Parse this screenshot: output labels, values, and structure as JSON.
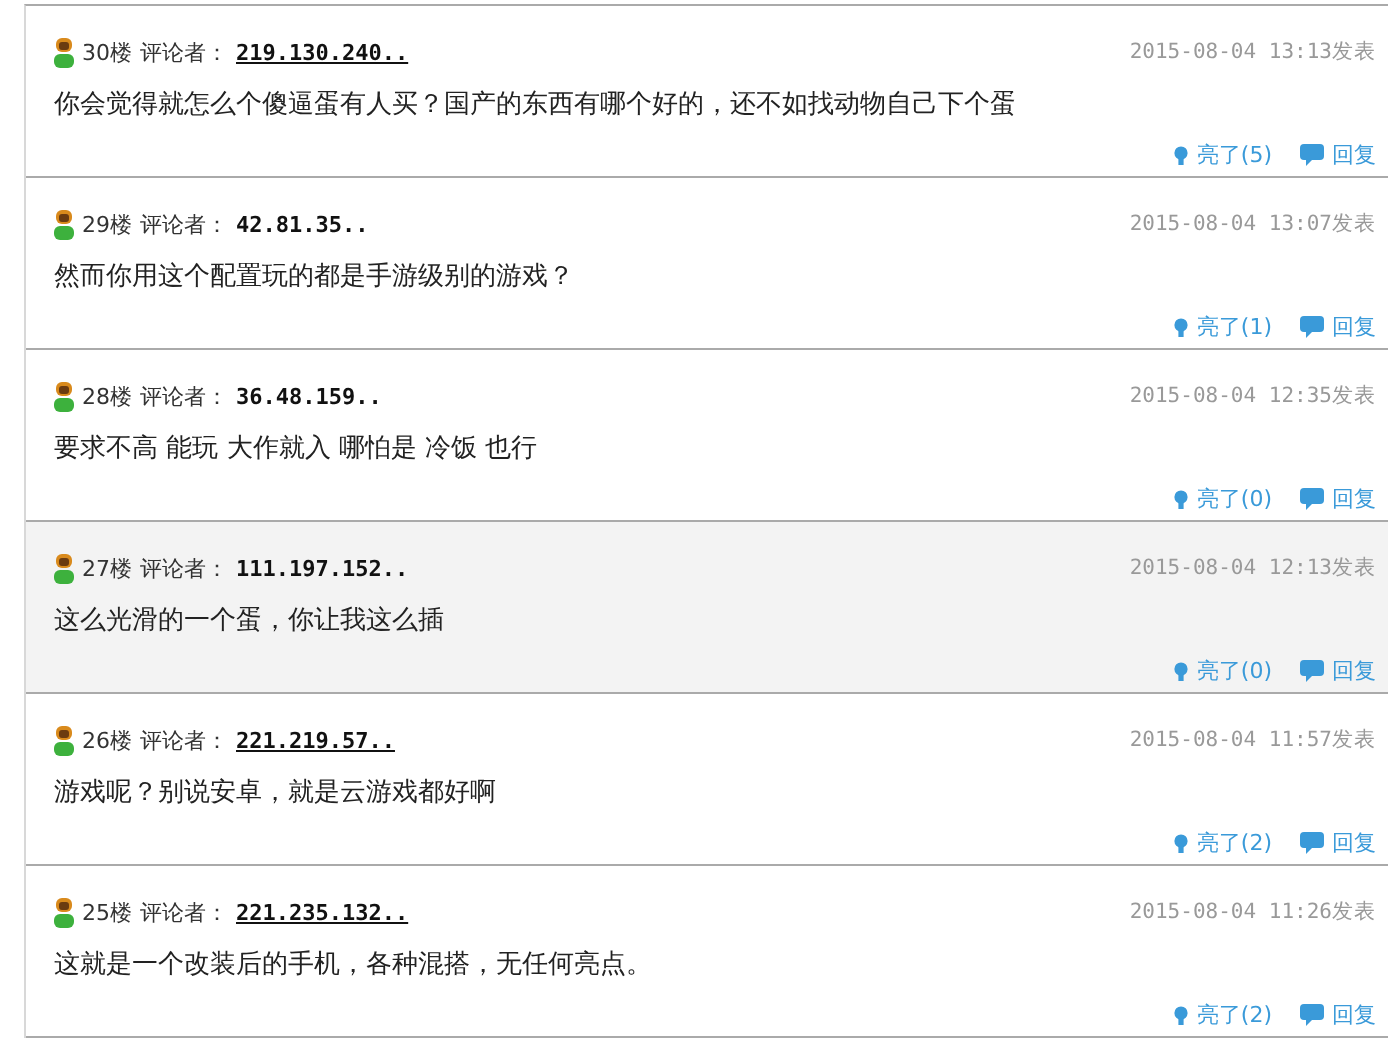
{
  "comments": [
    {
      "floor": "30楼",
      "reviewer_label": "评论者：",
      "ip": "219.130.240..",
      "ip_linked": true,
      "time": "2015-08-04 13:13发表",
      "text": "你会觉得就怎么个傻逼蛋有人买？国产的东西有哪个好的，还不如找动物自己下个蛋",
      "likes": "亮了(5)",
      "reply": "回复",
      "highlighted": false
    },
    {
      "floor": "29楼",
      "reviewer_label": "评论者：",
      "ip": "42.81.35..",
      "ip_linked": false,
      "time": "2015-08-04 13:07发表",
      "text": "然而你用这个配置玩的都是手游级别的游戏？",
      "likes": "亮了(1)",
      "reply": "回复",
      "highlighted": false
    },
    {
      "floor": "28楼",
      "reviewer_label": "评论者：",
      "ip": "36.48.159..",
      "ip_linked": false,
      "time": "2015-08-04 12:35发表",
      "text": "要求不高 能玩 大作就入 哪怕是 冷饭 也行",
      "likes": "亮了(0)",
      "reply": "回复",
      "highlighted": false
    },
    {
      "floor": "27楼",
      "reviewer_label": "评论者：",
      "ip": "111.197.152..",
      "ip_linked": false,
      "time": "2015-08-04 12:13发表",
      "text": "这么光滑的一个蛋，你让我这么插",
      "likes": "亮了(0)",
      "reply": "回复",
      "highlighted": true
    },
    {
      "floor": "26楼",
      "reviewer_label": "评论者：",
      "ip": "221.219.57..",
      "ip_linked": true,
      "time": "2015-08-04 11:57发表",
      "text": "游戏呢？别说安卓，就是云游戏都好啊",
      "likes": "亮了(2)",
      "reply": "回复",
      "highlighted": false
    },
    {
      "floor": "25楼",
      "reviewer_label": "评论者：",
      "ip": "221.235.132..",
      "ip_linked": true,
      "time": "2015-08-04 11:26发表",
      "text": "这就是一个改装后的手机，各种混搭，无任何亮点。",
      "likes": "亮了(2)",
      "reply": "回复",
      "highlighted": false
    }
  ]
}
